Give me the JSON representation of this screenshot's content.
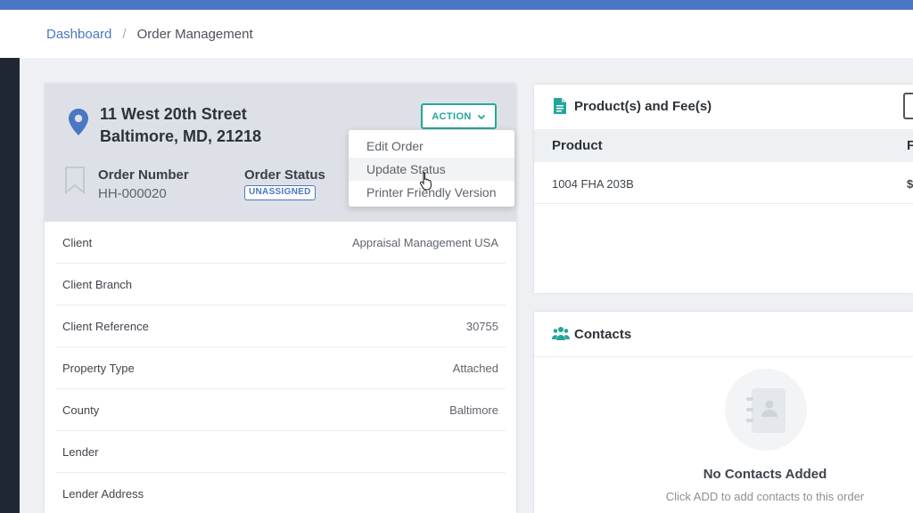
{
  "breadcrumb": {
    "home": "Dashboard",
    "separator": "/",
    "current": "Order Management"
  },
  "order": {
    "address_line1": "11 West 20th Street",
    "address_line2": "Baltimore, MD, 21218",
    "order_number_label": "Order Number",
    "order_number": "HH-000020",
    "order_status_label": "Order Status",
    "order_status": "UNASSIGNED",
    "action_label": "ACTION",
    "action_menu": [
      "Edit Order",
      "Update Status",
      "Printer Friendly Version"
    ],
    "details": [
      {
        "label": "Client",
        "value": "Appraisal Management USA"
      },
      {
        "label": "Client Branch",
        "value": ""
      },
      {
        "label": "Client Reference",
        "value": "30755"
      },
      {
        "label": "Property Type",
        "value": "Attached"
      },
      {
        "label": "County",
        "value": "Baltimore"
      },
      {
        "label": "Lender",
        "value": ""
      },
      {
        "label": "Lender Address",
        "value": ""
      }
    ]
  },
  "products": {
    "title": "Product(s) and Fee(s)",
    "col_product": "Product",
    "col_edge": "F",
    "rows": [
      {
        "name": "1004 FHA 203B",
        "edge": "$"
      }
    ]
  },
  "contacts": {
    "title": "Contacts",
    "empty_title": "No Contacts Added",
    "empty_subtitle": "Click ADD to add contacts to this order"
  },
  "colors": {
    "brand_blue": "#4a77c4",
    "accent_teal": "#23a69a",
    "sidebar_dark": "#1f2634"
  },
  "icons": [
    "map-pin-icon",
    "bookmark-icon",
    "chevron-down-icon",
    "document-icon",
    "users-icon",
    "address-book-icon",
    "pointer-cursor-icon"
  ]
}
